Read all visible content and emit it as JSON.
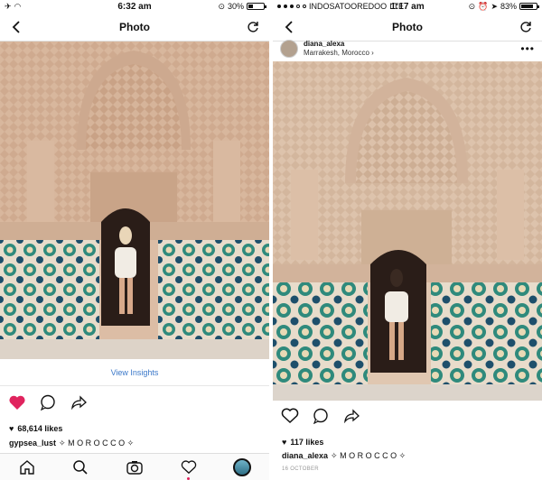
{
  "left": {
    "status": {
      "time": "6:32 am",
      "battery": "30%",
      "battery_level": 0.3
    },
    "nav": {
      "title": "Photo"
    },
    "insights_label": "View Insights",
    "likes": "68,614 likes",
    "caption": {
      "user": "gypsea_lust",
      "text": "✧ M O R O C C O ✧"
    }
  },
  "right": {
    "status": {
      "carrier": "INDOSATOOREDOO",
      "network": "LTE",
      "time": "1:17 am",
      "battery": "83%",
      "battery_level": 0.83
    },
    "nav": {
      "title": "Photo"
    },
    "post": {
      "user": "diana_alexa",
      "location": "Marrakesh, Morocco ›",
      "more": "•••"
    },
    "likes": "117 likes",
    "caption": {
      "user": "diana_alexa",
      "text": "✧ M O R O C C O ✧"
    },
    "date": "16 OCTOBER"
  },
  "colors": {
    "liked_heart": "#e0245e",
    "link": "#3b78c9",
    "wall": "#d9b79c",
    "tile_green": "#2f8a7c"
  },
  "icons": [
    "back-chevron-icon",
    "refresh-icon",
    "heart-icon",
    "comment-icon",
    "share-icon",
    "home-icon",
    "search-icon",
    "camera-icon",
    "activity-heart-icon",
    "profile-avatar"
  ]
}
